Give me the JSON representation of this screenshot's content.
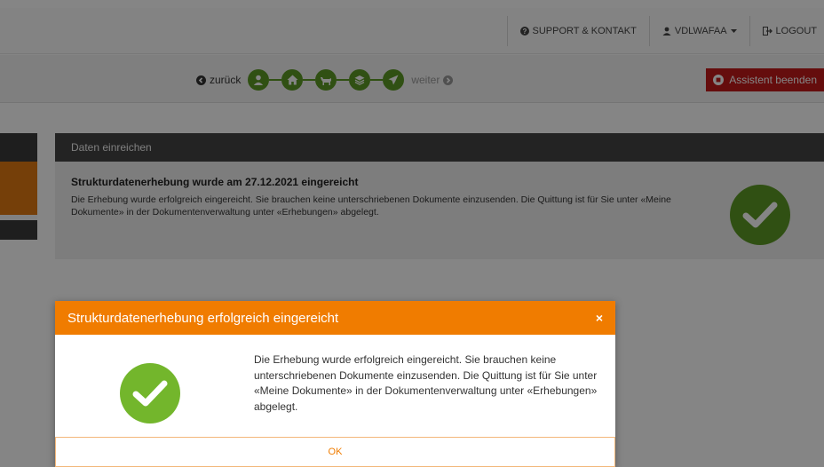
{
  "topnav": {
    "support_label": "SUPPORT & KONTAKT",
    "user_label": "VDLWAFAA",
    "logout_label": "LOGOUT"
  },
  "wizard": {
    "back_label": "zurück",
    "next_label": "weiter",
    "end_label": "Assistent beenden",
    "steps": [
      "user-icon",
      "home-icon",
      "cow-icon",
      "layers-icon",
      "send-icon"
    ]
  },
  "card": {
    "header": "Daten einreichen",
    "title": "Strukturdatenerhebung wurde am 27.12.2021 eingereicht",
    "text": "Die Erhebung wurde erfolgreich eingereicht. Sie brauchen keine unterschriebenen Dokumente einzusenden. Die Quittung ist für Sie unter «Meine Dokumente» in der Dokumentenverwaltung unter «Erhebungen» abgelegt."
  },
  "modal": {
    "title": "Strukturdatenerhebung erfolgreich eingereicht",
    "close": "×",
    "text": "Die Erhebung wurde erfolgreich eingereicht. Sie brauchen keine unterschriebenen Dokumente einzusenden. Die Quittung ist für Sie unter «Meine Dokumente» in der Dokumentenverwaltung unter «Erhebungen» abgelegt.",
    "ok_label": "OK"
  },
  "colors": {
    "accent_orange": "#f07c00",
    "success_green": "#73b62c",
    "danger_red": "#c11a1a"
  }
}
